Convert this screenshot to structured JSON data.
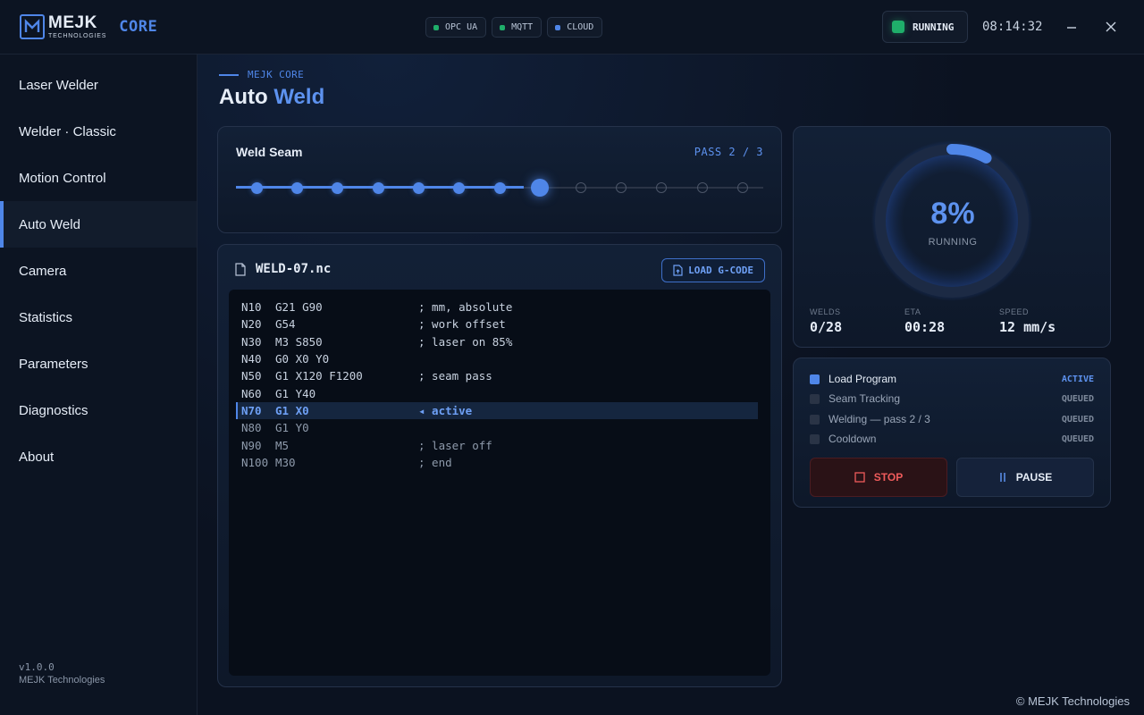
{
  "header": {
    "brand": "MEJK",
    "brand_sub": "TECHNOLOGIES",
    "product": "CORE",
    "connections": [
      {
        "label": "OPC UA",
        "color": "#1fae6a"
      },
      {
        "label": "MQTT",
        "color": "#1fae6a"
      },
      {
        "label": "CLOUD",
        "color": "#4f86e8"
      }
    ],
    "status": "RUNNING",
    "clock": "08:14:32",
    "minimize_icon": "minimize-icon",
    "close_icon": "close-icon"
  },
  "sidebar": {
    "items": [
      {
        "label": "Laser Welder"
      },
      {
        "label": "Welder · Classic"
      },
      {
        "label": "Motion Control"
      },
      {
        "label": "Auto Weld",
        "active": true
      },
      {
        "label": "Camera"
      },
      {
        "label": "Statistics"
      },
      {
        "label": "Parameters"
      },
      {
        "label": "Diagnostics"
      },
      {
        "label": "About"
      }
    ],
    "version": "v1.0.0",
    "company": "MEJK Technologies"
  },
  "page": {
    "crumb": "MEJK CORE",
    "title_main": "Auto",
    "title_accent": "Weld"
  },
  "seam": {
    "title": "Weld Seam",
    "pass": "PASS 2 / 3",
    "total_points": 13,
    "completed_points": 7,
    "current_index": 7
  },
  "program": {
    "file": "WELD-07.nc",
    "load_label": "LOAD G-CODE",
    "lines": [
      {
        "n": "N10",
        "cmd": "G21 G90",
        "comment": "; mm, absolute",
        "state": "done"
      },
      {
        "n": "N20",
        "cmd": "G54",
        "comment": "; work offset",
        "state": "done"
      },
      {
        "n": "N30",
        "cmd": "M3 S850",
        "comment": "; laser on 85%",
        "state": "done"
      },
      {
        "n": "N40",
        "cmd": "G0 X0 Y0",
        "comment": "",
        "state": "done"
      },
      {
        "n": "N50",
        "cmd": "G1 X120 F1200",
        "comment": "; seam pass",
        "state": "done"
      },
      {
        "n": "N60",
        "cmd": "G1 Y40",
        "comment": "",
        "state": "done"
      },
      {
        "n": "N70",
        "cmd": "G1 X0",
        "comment": "◂ active",
        "state": "active"
      },
      {
        "n": "N80",
        "cmd": "G1 Y0",
        "comment": "",
        "state": "pending"
      },
      {
        "n": "N90",
        "cmd": "M5",
        "comment": "; laser off",
        "state": "pending"
      },
      {
        "n": "N100",
        "cmd": "M30",
        "comment": "; end",
        "state": "pending"
      }
    ]
  },
  "progress": {
    "percent_value": 8,
    "percent_text": "8%",
    "label": "RUNNING",
    "stats": [
      {
        "key": "WELDS",
        "value": "0/28"
      },
      {
        "key": "ETA",
        "value": "00:28"
      },
      {
        "key": "SPEED",
        "value": "12 mm/s"
      }
    ]
  },
  "steps": {
    "items": [
      {
        "name": "Load Program",
        "state": "ACTIVE",
        "active": true
      },
      {
        "name": "Seam Tracking",
        "state": "QUEUED"
      },
      {
        "name": "Welding — pass 2 / 3",
        "state": "QUEUED"
      },
      {
        "name": "Cooldown",
        "state": "QUEUED"
      }
    ],
    "stop_label": "STOP",
    "pause_label": "PAUSE"
  },
  "footer": {
    "copyright": "© MEJK Technologies"
  },
  "colors": {
    "accent": "#4f86e8",
    "ok": "#1fae6a",
    "danger": "#ef5b5b"
  }
}
